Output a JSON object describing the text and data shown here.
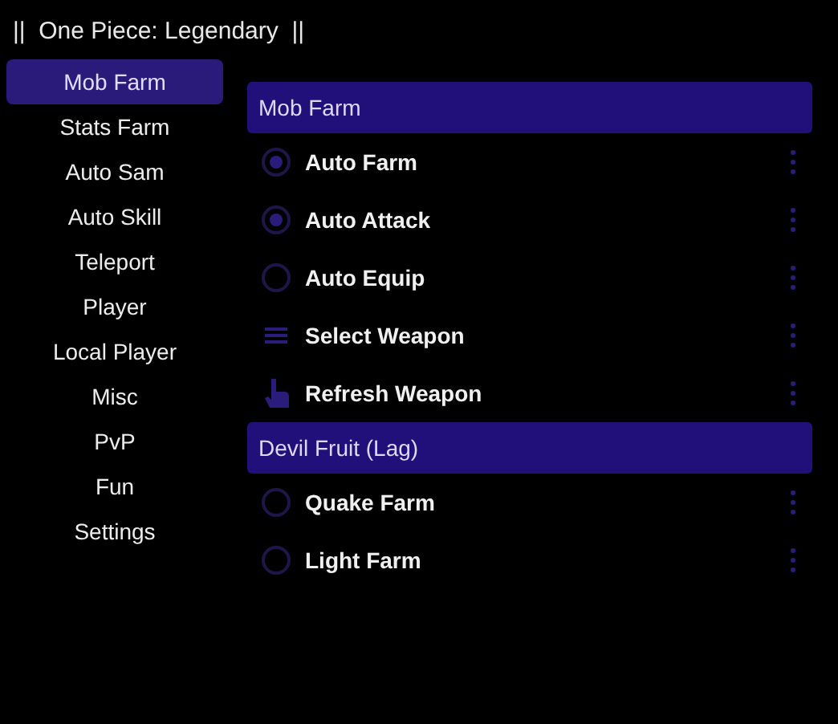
{
  "window": {
    "title": "||  One Piece: Legendary  ||"
  },
  "sidebar": {
    "items": [
      {
        "label": "Mob Farm",
        "selected": true
      },
      {
        "label": "Stats Farm",
        "selected": false
      },
      {
        "label": "Auto Sam",
        "selected": false
      },
      {
        "label": "Auto Skill",
        "selected": false
      },
      {
        "label": "Teleport",
        "selected": false
      },
      {
        "label": "Player",
        "selected": false
      },
      {
        "label": "Local Player",
        "selected": false
      },
      {
        "label": "Misc",
        "selected": false
      },
      {
        "label": "PvP",
        "selected": false
      },
      {
        "label": "Fun",
        "selected": false
      },
      {
        "label": "Settings",
        "selected": false
      }
    ]
  },
  "sections": [
    {
      "title": "Mob Farm",
      "rows": [
        {
          "kind": "toggle",
          "label": "Auto Farm",
          "checked": true
        },
        {
          "kind": "toggle",
          "label": "Auto Attack",
          "checked": true
        },
        {
          "kind": "toggle",
          "label": "Auto Equip",
          "checked": false
        },
        {
          "kind": "dropdown",
          "label": "Select Weapon"
        },
        {
          "kind": "button",
          "label": "Refresh Weapon"
        }
      ]
    },
    {
      "title": "Devil Fruit (Lag)",
      "rows": [
        {
          "kind": "toggle",
          "label": "Quake Farm",
          "checked": false
        },
        {
          "kind": "toggle",
          "label": "Light Farm",
          "checked": false
        }
      ]
    }
  ]
}
